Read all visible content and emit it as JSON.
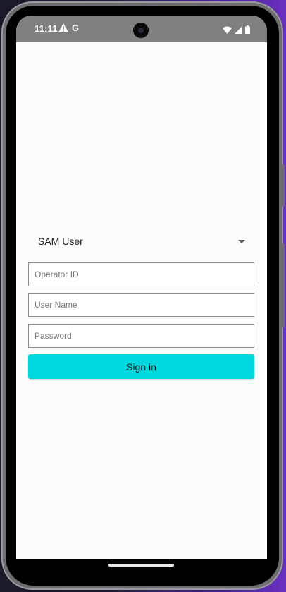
{
  "statusbar": {
    "time": "11:11",
    "notification_letter": "G",
    "icons": [
      "warning-icon",
      "wifi-icon",
      "signal-icon",
      "battery-icon"
    ]
  },
  "login": {
    "user_type_selected": "SAM User",
    "operator_id_placeholder": "Operator ID",
    "user_name_placeholder": "User Name",
    "password_placeholder": "Password",
    "signin_label": "Sign in"
  },
  "colors": {
    "accent": "#00d8e0",
    "statusbar": "#808080",
    "field_border": "#8a8a8a"
  }
}
